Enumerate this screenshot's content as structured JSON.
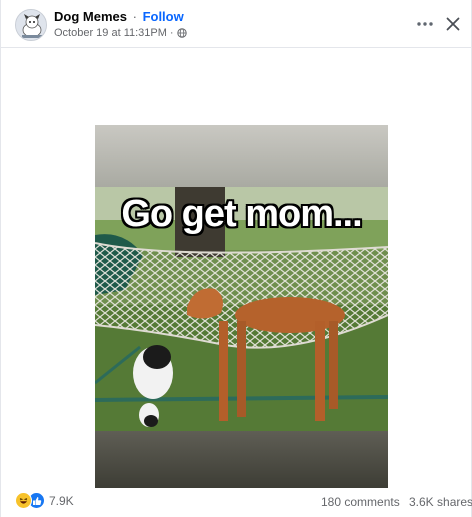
{
  "post": {
    "page_name": "Dog Memes",
    "separator": "·",
    "follow_label": "Follow",
    "timestamp": "October 19 at 11:31PM",
    "timestamp_separator": "·",
    "privacy_icon": "globe-icon"
  },
  "header_actions": {
    "more_icon": "more-horizontal-icon",
    "close_icon": "close-icon"
  },
  "media": {
    "meme_caption": "Go get mom..."
  },
  "footer": {
    "reaction_icons": [
      "haha-reaction-icon",
      "like-reaction-icon"
    ],
    "reaction_count": "7.9K",
    "comments": "180 comments",
    "shares": "3.6K shares"
  },
  "colors": {
    "accent": "#0866ff",
    "secondary_text": "#65676b",
    "like_blue": "#1877f2",
    "haha_yellow": "#f7c22b"
  }
}
